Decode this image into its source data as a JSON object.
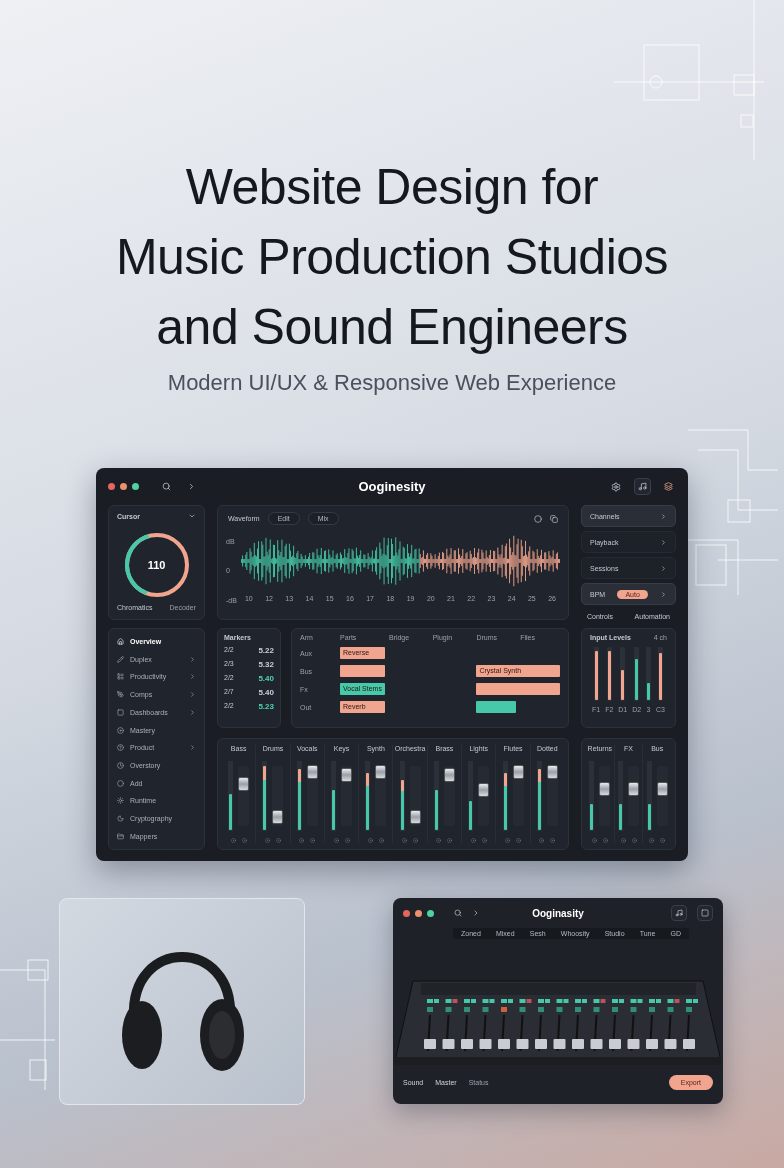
{
  "hero": {
    "title_lines": [
      "Website Design for",
      "Music Production Studios",
      "and Sound Engineers"
    ],
    "subtitle": "Modern UI/UX & Responsive Web Experience"
  },
  "dashboard": {
    "title": "Ooginesity",
    "cursor_card": {
      "title": "Cursor",
      "value": "110",
      "level": 0.4,
      "footer": [
        "Chromatics",
        "Decoder"
      ]
    },
    "waveform": {
      "title": "Waveform",
      "tabs": [
        {
          "label": "Edit",
          "selected": false
        },
        {
          "label": "Mix",
          "selected": false
        }
      ],
      "y_labels": [
        "dB",
        "0",
        "-dB"
      ],
      "x_labels": [
        "10",
        "12",
        "13",
        "14",
        "15",
        "16",
        "17",
        "18",
        "19",
        "20",
        "21",
        "22",
        "23",
        "24",
        "25",
        "26"
      ]
    },
    "side_menu": [
      {
        "label": "Channels",
        "selected": true
      },
      {
        "label": "Playback",
        "selected": false
      },
      {
        "label": "Sessions",
        "selected": false
      },
      {
        "label": "BPM",
        "selected": true,
        "pill": "Auto"
      }
    ],
    "side_footer": [
      "Controls",
      "Automation"
    ],
    "sidebar": [
      {
        "label": "Overview",
        "selected": true,
        "submenu": false
      },
      {
        "label": "Duplex",
        "selected": false,
        "submenu": true
      },
      {
        "label": "Productivity",
        "selected": false,
        "submenu": true
      },
      {
        "label": "Comps",
        "selected": false,
        "submenu": true
      },
      {
        "label": "Dashboards",
        "selected": false,
        "submenu": true
      },
      {
        "label": "Mastery",
        "selected": false,
        "submenu": false
      },
      {
        "label": "Product",
        "selected": false,
        "submenu": true
      },
      {
        "label": "Overstory",
        "selected": false,
        "submenu": false
      },
      {
        "label": "Add",
        "selected": false,
        "submenu": false
      },
      {
        "label": "Runtime",
        "selected": false,
        "submenu": false
      },
      {
        "label": "Cryptography",
        "selected": false,
        "submenu": false
      },
      {
        "label": "Mappers",
        "selected": false,
        "submenu": false
      }
    ],
    "markers": {
      "title": "Markers",
      "rows": [
        {
          "time": "2/2",
          "value": "5.22",
          "color": "#c9ced6"
        },
        {
          "time": "2/3",
          "value": "5.32",
          "color": "#c9ced6"
        },
        {
          "time": "2/2",
          "value": "5.40",
          "color": "#4fd1b0"
        },
        {
          "time": "2/7",
          "value": "5.40",
          "color": "#c9ced6"
        },
        {
          "time": "2/2",
          "value": "5.23",
          "color": "#4fd1b0"
        }
      ]
    },
    "arrangement": {
      "columns": [
        "Arm",
        "Parts",
        "Bridge",
        "Plugin",
        "Drums",
        "Files"
      ],
      "lanes": [
        {
          "label": "Aux",
          "slots": [
            {
              "kind": "clip",
              "label": "Reverse",
              "color": "#f2a58e"
            },
            {
              "kind": "empty"
            },
            {
              "kind": "empty"
            },
            {
              "kind": "empty"
            },
            {
              "kind": "empty"
            }
          ]
        },
        {
          "label": "Bus",
          "slots": [
            {
              "kind": "clip",
              "color": "#f2a58e"
            },
            {
              "kind": "empty"
            },
            {
              "kind": "empty"
            },
            {
              "kind": "wide",
              "label": "Crystal Synth",
              "color": "#f2a58e"
            }
          ]
        },
        {
          "label": "Fx",
          "slots": [
            {
              "kind": "clip",
              "label": "Vocal Stems",
              "color": "#45c9a8"
            },
            {
              "kind": "empty"
            },
            {
              "kind": "empty"
            },
            {
              "kind": "wide",
              "color": "#f2a58e"
            }
          ]
        },
        {
          "label": "Out",
          "slots": [
            {
              "kind": "clip",
              "label": "Reverb",
              "color": "#f2a58e"
            },
            {
              "kind": "empty"
            },
            {
              "kind": "empty"
            },
            {
              "kind": "clip",
              "color": "#45c9a8"
            },
            {
              "kind": "empty"
            }
          ]
        }
      ]
    },
    "level_meters": {
      "title": "Input Levels",
      "badge": "4 ch",
      "bars": [
        {
          "label": "F1",
          "level": 0.95,
          "color": "#f2a58e"
        },
        {
          "label": "F2",
          "level": 0.95,
          "color": "#f2a58e"
        },
        {
          "label": "D1",
          "level": 0.6,
          "color": "#f2a58e"
        },
        {
          "label": "D2",
          "level": 0.8,
          "color": "#45c9a8"
        },
        {
          "label": "3",
          "level": 0.35,
          "color": "#45c9a8"
        },
        {
          "label": "C3",
          "level": 0.9,
          "color": "#f2a58e"
        }
      ]
    },
    "mixer": {
      "channels": [
        {
          "name": "Bass",
          "fader": {
            "level": 0.7
          },
          "meter": {
            "level": 0.55,
            "peak": false
          }
        },
        {
          "name": "Drums",
          "fader": {
            "level": 0.15
          },
          "meter": {
            "level": 0.95,
            "peak": true
          }
        },
        {
          "name": "Vocals",
          "fader": {
            "level": 0.9
          },
          "meter": {
            "level": 0.9,
            "peak": true
          }
        },
        {
          "name": "Keys",
          "fader": {
            "level": 0.85
          },
          "meter": {
            "level": 0.6,
            "peak": false
          }
        },
        {
          "name": "Synth",
          "fader": {
            "level": 0.9
          },
          "meter": {
            "level": 0.85,
            "peak": true
          }
        },
        {
          "name": "Orchestra",
          "fader": {
            "level": 0.15
          },
          "meter": {
            "level": 0.75,
            "peak": true
          }
        },
        {
          "name": "Brass",
          "fader": {
            "level": 0.85
          },
          "meter": {
            "level": 0.6,
            "peak": false
          }
        },
        {
          "name": "Lights",
          "fader": {
            "level": 0.6
          },
          "meter": {
            "level": 0.45,
            "peak": false
          }
        },
        {
          "name": "Flutes",
          "fader": {
            "level": 0.9
          },
          "meter": {
            "level": 0.85,
            "peak": true
          }
        },
        {
          "name": "Dotted",
          "fader": {
            "level": 0.9
          },
          "meter": {
            "level": 0.9,
            "peak": true
          }
        }
      ]
    },
    "bus_mixer": {
      "channels": [
        {
          "name": "Returns",
          "fader": {
            "level": 0.62
          },
          "meter": {
            "level": 0.4,
            "peak": false
          }
        },
        {
          "name": "FX",
          "fader": {
            "level": 0.62
          },
          "meter": {
            "level": 0.4,
            "peak": false
          }
        },
        {
          "name": "Bus",
          "fader": {
            "level": 0.62
          },
          "meter": {
            "level": 0.4,
            "peak": false
          }
        }
      ]
    }
  },
  "mini_window": {
    "title": "Ooginasity",
    "tabs": [
      "Zoned",
      "Mixed",
      "Sesh",
      "Whoosity",
      "Studio",
      "Tune",
      "GD"
    ],
    "footer": [
      "Sound",
      "Master",
      "Status"
    ],
    "button": "Export"
  }
}
